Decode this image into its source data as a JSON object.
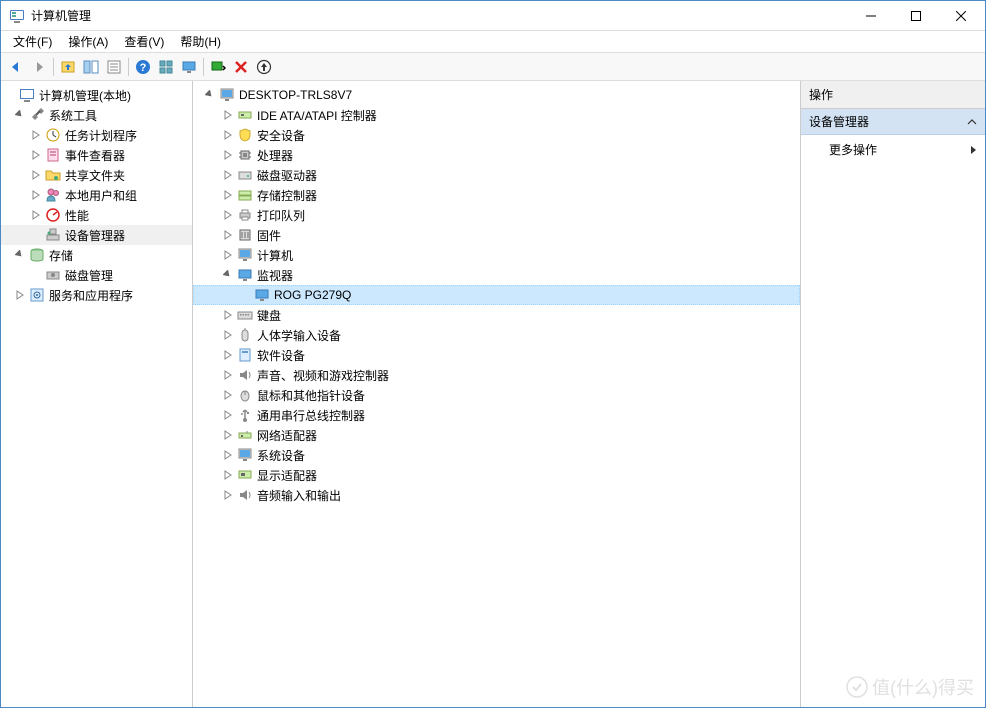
{
  "window": {
    "title": "计算机管理"
  },
  "menu": {
    "file": "文件(F)",
    "action": "操作(A)",
    "view": "查看(V)",
    "help": "帮助(H)"
  },
  "leftTree": {
    "root": "计算机管理(本地)",
    "systemTools": "系统工具",
    "taskScheduler": "任务计划程序",
    "eventViewer": "事件查看器",
    "sharedFolders": "共享文件夹",
    "localUsersGroups": "本地用户和组",
    "performance": "性能",
    "deviceManager": "设备管理器",
    "storage": "存储",
    "diskManagement": "磁盘管理",
    "servicesApps": "服务和应用程序"
  },
  "deviceTree": {
    "root": "DESKTOP-TRLS8V7",
    "ideAtapi": "IDE ATA/ATAPI 控制器",
    "securityDevices": "安全设备",
    "processors": "处理器",
    "diskDrives": "磁盘驱动器",
    "storageControllers": "存储控制器",
    "printQueues": "打印队列",
    "firmware": "固件",
    "computers": "计算机",
    "monitors": "监视器",
    "monitorItem": "ROG PG279Q",
    "keyboards": "键盘",
    "hid": "人体学输入设备",
    "softwareDevices": "软件设备",
    "soundVideo": "声音、视频和游戏控制器",
    "miceOther": "鼠标和其他指针设备",
    "usbControllers": "通用串行总线控制器",
    "networkAdapters": "网络适配器",
    "systemDevices": "系统设备",
    "displayAdapters": "显示适配器",
    "audioIO": "音频输入和输出"
  },
  "actions": {
    "header": "操作",
    "section": "设备管理器",
    "moreActions": "更多操作"
  },
  "watermark": "值(什么)得买"
}
